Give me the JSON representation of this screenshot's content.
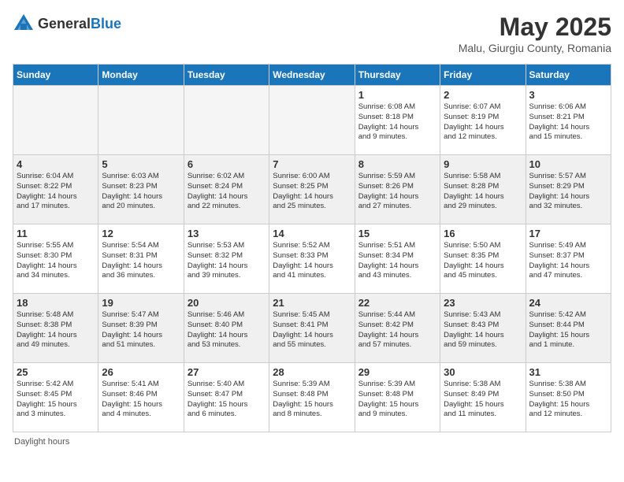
{
  "header": {
    "logo_general": "General",
    "logo_blue": "Blue",
    "month_year": "May 2025",
    "location": "Malu, Giurgiu County, Romania"
  },
  "days_of_week": [
    "Sunday",
    "Monday",
    "Tuesday",
    "Wednesday",
    "Thursday",
    "Friday",
    "Saturday"
  ],
  "footer": {
    "note": "Daylight hours"
  },
  "weeks": [
    [
      {
        "day": "",
        "info": "",
        "empty": true
      },
      {
        "day": "",
        "info": "",
        "empty": true
      },
      {
        "day": "",
        "info": "",
        "empty": true
      },
      {
        "day": "",
        "info": "",
        "empty": true
      },
      {
        "day": "1",
        "info": "Sunrise: 6:08 AM\nSunset: 8:18 PM\nDaylight: 14 hours\nand 9 minutes."
      },
      {
        "day": "2",
        "info": "Sunrise: 6:07 AM\nSunset: 8:19 PM\nDaylight: 14 hours\nand 12 minutes."
      },
      {
        "day": "3",
        "info": "Sunrise: 6:06 AM\nSunset: 8:21 PM\nDaylight: 14 hours\nand 15 minutes."
      }
    ],
    [
      {
        "day": "4",
        "info": "Sunrise: 6:04 AM\nSunset: 8:22 PM\nDaylight: 14 hours\nand 17 minutes."
      },
      {
        "day": "5",
        "info": "Sunrise: 6:03 AM\nSunset: 8:23 PM\nDaylight: 14 hours\nand 20 minutes."
      },
      {
        "day": "6",
        "info": "Sunrise: 6:02 AM\nSunset: 8:24 PM\nDaylight: 14 hours\nand 22 minutes."
      },
      {
        "day": "7",
        "info": "Sunrise: 6:00 AM\nSunset: 8:25 PM\nDaylight: 14 hours\nand 25 minutes."
      },
      {
        "day": "8",
        "info": "Sunrise: 5:59 AM\nSunset: 8:26 PM\nDaylight: 14 hours\nand 27 minutes."
      },
      {
        "day": "9",
        "info": "Sunrise: 5:58 AM\nSunset: 8:28 PM\nDaylight: 14 hours\nand 29 minutes."
      },
      {
        "day": "10",
        "info": "Sunrise: 5:57 AM\nSunset: 8:29 PM\nDaylight: 14 hours\nand 32 minutes."
      }
    ],
    [
      {
        "day": "11",
        "info": "Sunrise: 5:55 AM\nSunset: 8:30 PM\nDaylight: 14 hours\nand 34 minutes."
      },
      {
        "day": "12",
        "info": "Sunrise: 5:54 AM\nSunset: 8:31 PM\nDaylight: 14 hours\nand 36 minutes."
      },
      {
        "day": "13",
        "info": "Sunrise: 5:53 AM\nSunset: 8:32 PM\nDaylight: 14 hours\nand 39 minutes."
      },
      {
        "day": "14",
        "info": "Sunrise: 5:52 AM\nSunset: 8:33 PM\nDaylight: 14 hours\nand 41 minutes."
      },
      {
        "day": "15",
        "info": "Sunrise: 5:51 AM\nSunset: 8:34 PM\nDaylight: 14 hours\nand 43 minutes."
      },
      {
        "day": "16",
        "info": "Sunrise: 5:50 AM\nSunset: 8:35 PM\nDaylight: 14 hours\nand 45 minutes."
      },
      {
        "day": "17",
        "info": "Sunrise: 5:49 AM\nSunset: 8:37 PM\nDaylight: 14 hours\nand 47 minutes."
      }
    ],
    [
      {
        "day": "18",
        "info": "Sunrise: 5:48 AM\nSunset: 8:38 PM\nDaylight: 14 hours\nand 49 minutes."
      },
      {
        "day": "19",
        "info": "Sunrise: 5:47 AM\nSunset: 8:39 PM\nDaylight: 14 hours\nand 51 minutes."
      },
      {
        "day": "20",
        "info": "Sunrise: 5:46 AM\nSunset: 8:40 PM\nDaylight: 14 hours\nand 53 minutes."
      },
      {
        "day": "21",
        "info": "Sunrise: 5:45 AM\nSunset: 8:41 PM\nDaylight: 14 hours\nand 55 minutes."
      },
      {
        "day": "22",
        "info": "Sunrise: 5:44 AM\nSunset: 8:42 PM\nDaylight: 14 hours\nand 57 minutes."
      },
      {
        "day": "23",
        "info": "Sunrise: 5:43 AM\nSunset: 8:43 PM\nDaylight: 14 hours\nand 59 minutes."
      },
      {
        "day": "24",
        "info": "Sunrise: 5:42 AM\nSunset: 8:44 PM\nDaylight: 15 hours\nand 1 minute."
      }
    ],
    [
      {
        "day": "25",
        "info": "Sunrise: 5:42 AM\nSunset: 8:45 PM\nDaylight: 15 hours\nand 3 minutes."
      },
      {
        "day": "26",
        "info": "Sunrise: 5:41 AM\nSunset: 8:46 PM\nDaylight: 15 hours\nand 4 minutes."
      },
      {
        "day": "27",
        "info": "Sunrise: 5:40 AM\nSunset: 8:47 PM\nDaylight: 15 hours\nand 6 minutes."
      },
      {
        "day": "28",
        "info": "Sunrise: 5:39 AM\nSunset: 8:48 PM\nDaylight: 15 hours\nand 8 minutes."
      },
      {
        "day": "29",
        "info": "Sunrise: 5:39 AM\nSunset: 8:48 PM\nDaylight: 15 hours\nand 9 minutes."
      },
      {
        "day": "30",
        "info": "Sunrise: 5:38 AM\nSunset: 8:49 PM\nDaylight: 15 hours\nand 11 minutes."
      },
      {
        "day": "31",
        "info": "Sunrise: 5:38 AM\nSunset: 8:50 PM\nDaylight: 15 hours\nand 12 minutes."
      }
    ]
  ]
}
